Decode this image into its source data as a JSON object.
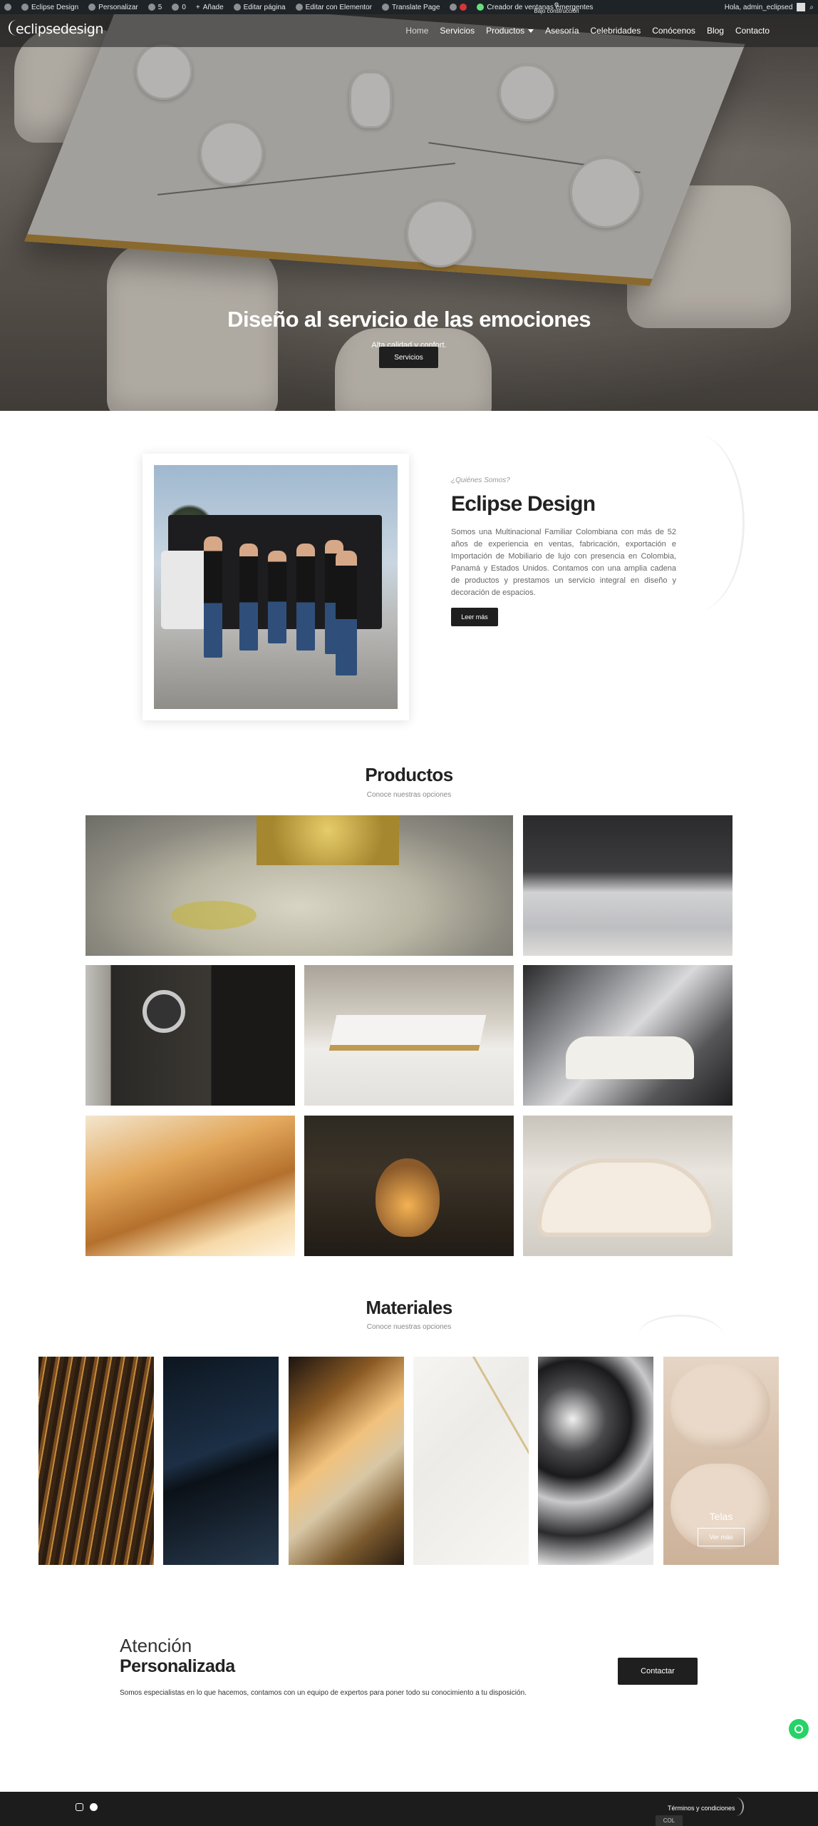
{
  "admin_bar": {
    "site": "Eclipse Design",
    "customize": "Personalizar",
    "updates": "5",
    "comments": "0",
    "new": "Añade",
    "edit_page": "Editar página",
    "elementor": "Editar con Elementor",
    "translate": "Translate Page",
    "popups": "Creador de ventanas emergentes",
    "construction": "Bajo construcción",
    "greeting": "Hola, admin_eclipsed"
  },
  "nav": {
    "logo": "eclipsedesign",
    "items": [
      "Home",
      "Servicios",
      "Productos",
      "Asesoría",
      "Celebridades",
      "Conócenos",
      "Blog",
      "Contacto"
    ]
  },
  "hero": {
    "title": "Diseño al servicio de las emociones",
    "subtitle": "Alta calidad y confort.",
    "button": "Servicios"
  },
  "about": {
    "kicker": "¿Quiénes Somos?",
    "title": "Eclipse Design",
    "text": "Somos una Multinacional Familiar Colombiana con más de 52 años de experiencia en ventas, fabricación, exportación e Importación de Mobiliario de lujo con presencia en Colombia, Panamá y Estados Unidos. Contamos con una amplia cadena de productos y prestamos un servicio integral en diseño y decoración de espacios.",
    "button": "Leer más"
  },
  "products": {
    "title": "Productos",
    "subtitle": "Conoce nuestras opciones"
  },
  "materials": {
    "title": "Materiales",
    "subtitle": "Conoce nuestras opciones",
    "hover_label": "Telas",
    "hover_button": "Ver más"
  },
  "attention": {
    "line1": "Atención",
    "line2": "Personalizada",
    "text": "Somos especialistas en lo que hacemos, contamos con un equipo de expertos para poner todo su conocimiento a tu disposición.",
    "button": "Contactar"
  },
  "footer": {
    "terms": "Términos y condiciones",
    "lang": "COL"
  }
}
